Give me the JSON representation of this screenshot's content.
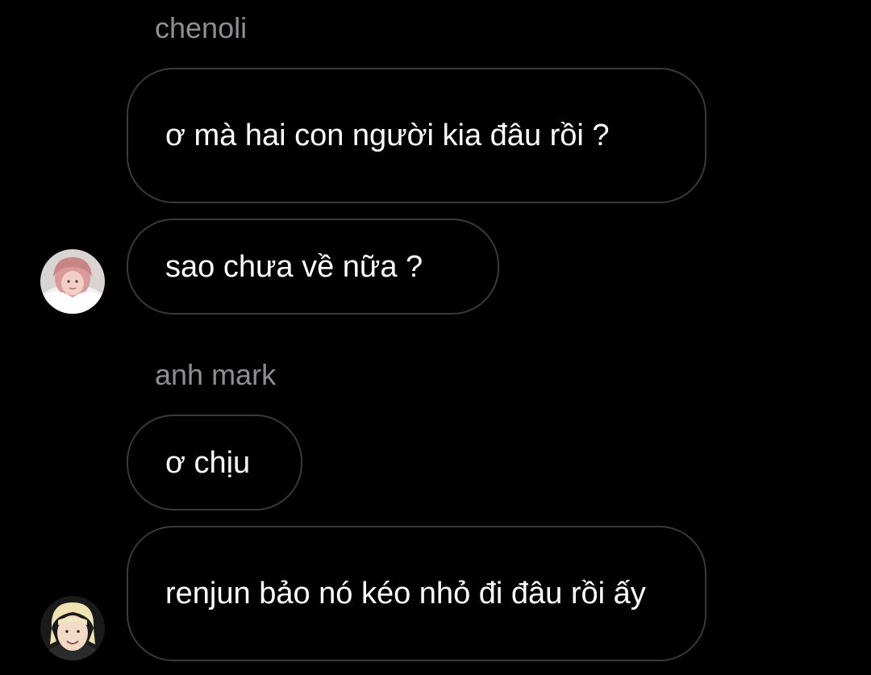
{
  "messages": [
    {
      "sender": "chenoli",
      "bubbles": [
        {
          "text": "ơ mà hai con người kia đâu rồi ?"
        },
        {
          "text": "sao chưa về nữa ?"
        }
      ],
      "avatar": "pink-hair-avatar"
    },
    {
      "sender": "anh mark",
      "bubbles": [
        {
          "text": "ơ chịu"
        },
        {
          "text": "renjun bảo nó kéo nhỏ đi đâu rồi ấy"
        }
      ],
      "avatar": "blond-hair-avatar"
    }
  ],
  "colors": {
    "background": "#000000",
    "bubble_border": "#3a3a3c",
    "sender_name": "#8e8e93",
    "text": "#ffffff"
  }
}
